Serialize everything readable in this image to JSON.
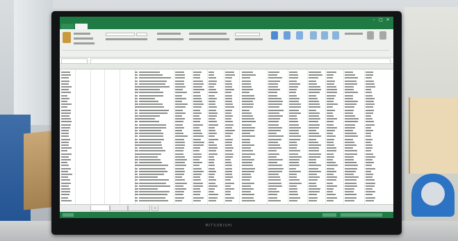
{
  "scene": {
    "monitor_brand": "MITSUBISHI",
    "accent_color": "#1f7a44"
  },
  "excel": {
    "title": "",
    "sheet_tabs": [
      "",
      "",
      ""
    ],
    "rows": 45
  }
}
